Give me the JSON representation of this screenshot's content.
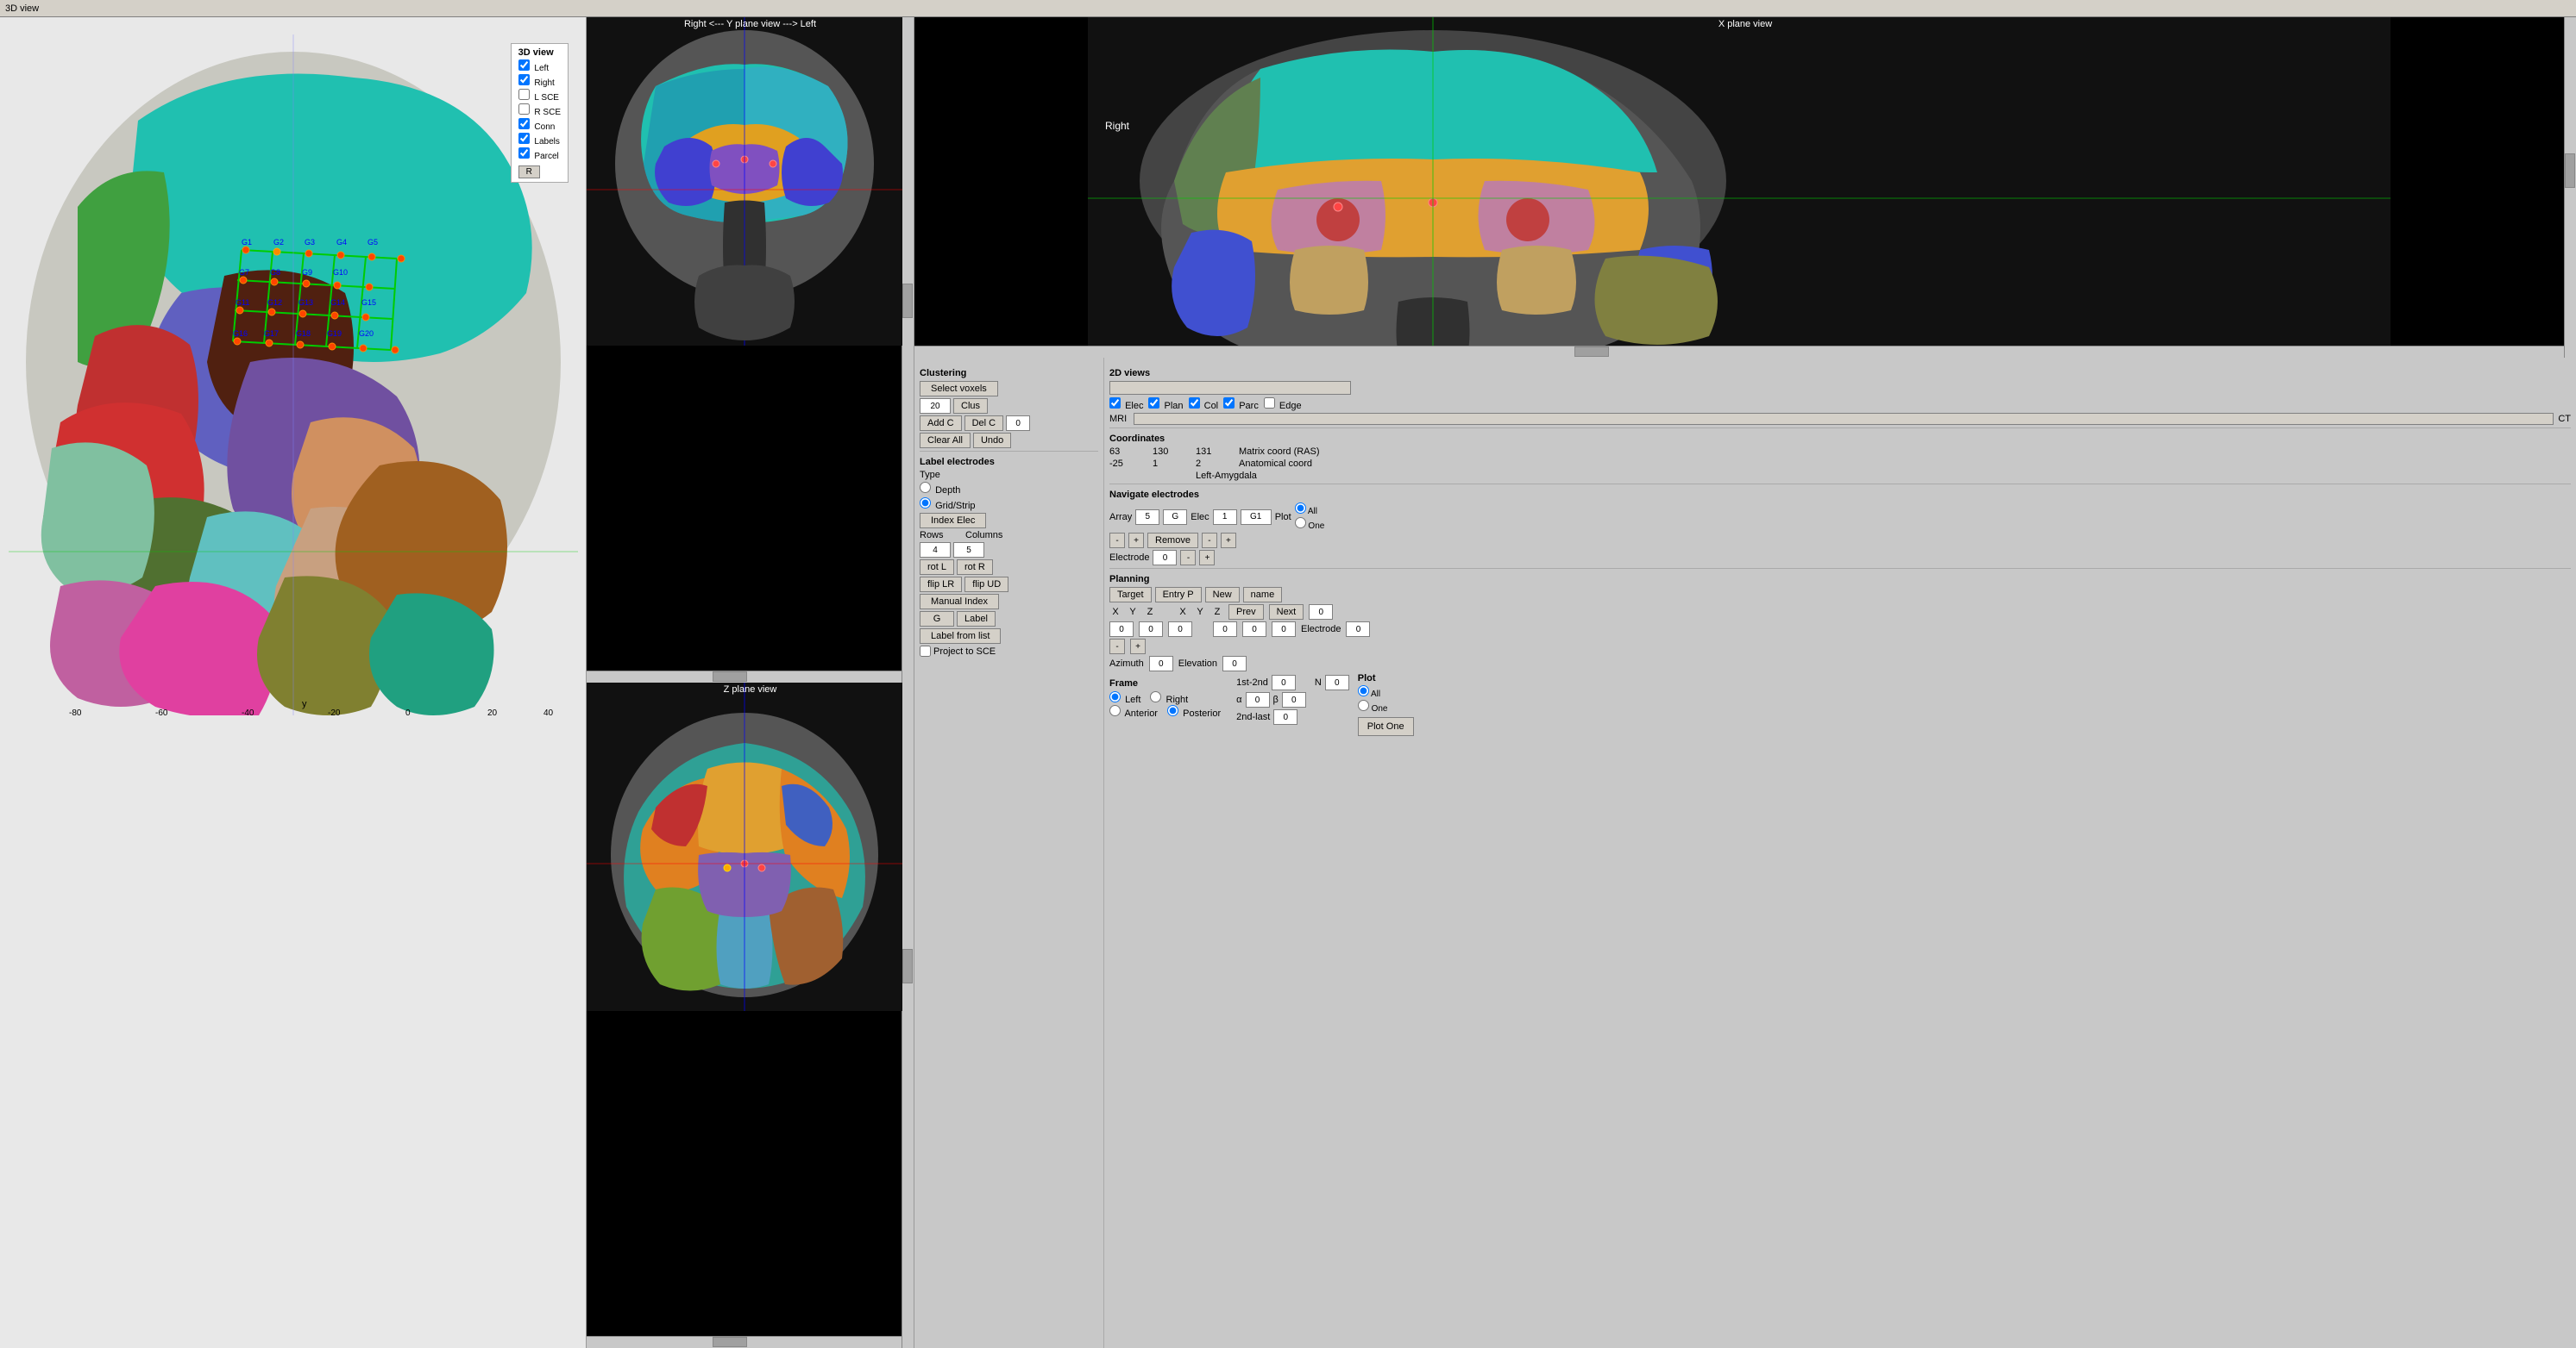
{
  "title_3d": "3D view",
  "overlay3d": {
    "title": "3D view",
    "items": [
      {
        "label": "Left",
        "checked": true
      },
      {
        "label": "Right",
        "checked": true
      },
      {
        "label": "L SCE",
        "checked": false
      },
      {
        "label": "R SCE",
        "checked": false
      },
      {
        "label": "Conn",
        "checked": true
      },
      {
        "label": "Labels",
        "checked": true
      },
      {
        "label": "Parcel",
        "checked": true
      }
    ],
    "r_button": "R"
  },
  "y_plane": {
    "label": "Right <---   Y plane view   ---> Left"
  },
  "z_plane": {
    "label": "Z plane view"
  },
  "x_plane": {
    "label": "X plane view"
  },
  "clustering": {
    "title": "Clustering",
    "select_voxels_btn": "Select voxels",
    "clus_value": "20",
    "clus_btn": "Clus",
    "add_c_btn": "Add C",
    "del_c_btn": "Del C",
    "del_c_val": "0",
    "clear_all_btn": "Clear All",
    "undo_btn": "Undo"
  },
  "label_electrodes": {
    "title": "Label electrodes",
    "type_label": "Type",
    "depth_label": "Depth",
    "grid_strip_label": "Grid/Strip",
    "index_elec_btn": "Index Elec",
    "rows_label": "Rows",
    "rows_value": "4",
    "cols_label": "Columns",
    "cols_value": "5",
    "rot_l_btn": "rot L",
    "rot_r_btn": "rot R",
    "flip_lr_btn": "flip LR",
    "flip_ud_btn": "flip UD",
    "manual_index_btn": "Manual Index",
    "g_btn": "G",
    "label_btn": "Label",
    "label_from_list_btn": "Label from list",
    "project_sce_label": "Project to SCE"
  },
  "views_2d": {
    "title": "2D views",
    "slider_val": "",
    "elec_check": true,
    "elec_label": "Elec",
    "plan_check": true,
    "plan_label": "Plan",
    "col_check": true,
    "col_label": "Col",
    "parc_check": true,
    "parc_label": "Parc",
    "edge_check": false,
    "edge_label": "Edge",
    "mri_label": "MRI",
    "ct_label": "CT"
  },
  "coordinates": {
    "title": "Coordinates",
    "x1": "63",
    "y1": "130",
    "z1": "131",
    "matrix_label": "Matrix coord (RAS)",
    "x2": "-25",
    "y2": "1",
    "z2": "2",
    "anat_label": "Anatomical coord",
    "region_label": "Left-Amygdala"
  },
  "navigate": {
    "title": "Navigate electrodes",
    "array_label": "Array",
    "array_val": "5",
    "g_label": "G",
    "elec_label": "Elec",
    "elec_val": "1",
    "g1_label": "G1",
    "plot_label": "Plot",
    "minus_arr": "-",
    "plus_arr": "+",
    "remove_btn": "Remove",
    "minus_elec": "-",
    "plus_elec": "+",
    "all_label": "All",
    "one_label": "One",
    "electrode_label": "Electrode",
    "electrode_val": "0",
    "elec_minus": "-",
    "elec_plus": "+"
  },
  "planning": {
    "title": "Planning",
    "target_btn": "Target",
    "entry_p_btn": "Entry P",
    "new_btn": "New",
    "name_btn": "name",
    "x_label": "X",
    "y_label": "Y",
    "z_label": "Z",
    "x2_label": "X",
    "y2_label": "Y",
    "z2_label": "Z",
    "prev_btn": "Prev",
    "next_btn": "Next",
    "val_after_next": "0",
    "target_x": "0",
    "target_y": "0",
    "target_z": "0",
    "entry_x": "0",
    "entry_y": "0",
    "entry_z": "0",
    "azimuth_label": "Azimuth",
    "azimuth_val": "0",
    "elevation_label": "Elevation",
    "elevation_val": "0",
    "frame_label": "Frame",
    "left_label": "Left",
    "right_label": "Right",
    "anterior_label": "Anterior",
    "posterior_label": "Posterior",
    "n_label": "N",
    "n_val": "0",
    "first_second_label": "1st-2nd",
    "first_second_val": "0",
    "alpha_label": "α",
    "alpha_val": "0",
    "beta_label": "β",
    "beta_val": "0",
    "second_last_label": "2nd-last",
    "second_last_val": "0",
    "plot_label2": "Plot",
    "all_label2": "All",
    "one_label2": "One",
    "plot_one_btn": "Plot One"
  },
  "axis_labels": {
    "y": "y",
    "minus80": "-80",
    "minus60": "-60",
    "minus40": "-40",
    "minus20": "-20",
    "zero": "0",
    "plus20": "20",
    "plus40": "40"
  }
}
